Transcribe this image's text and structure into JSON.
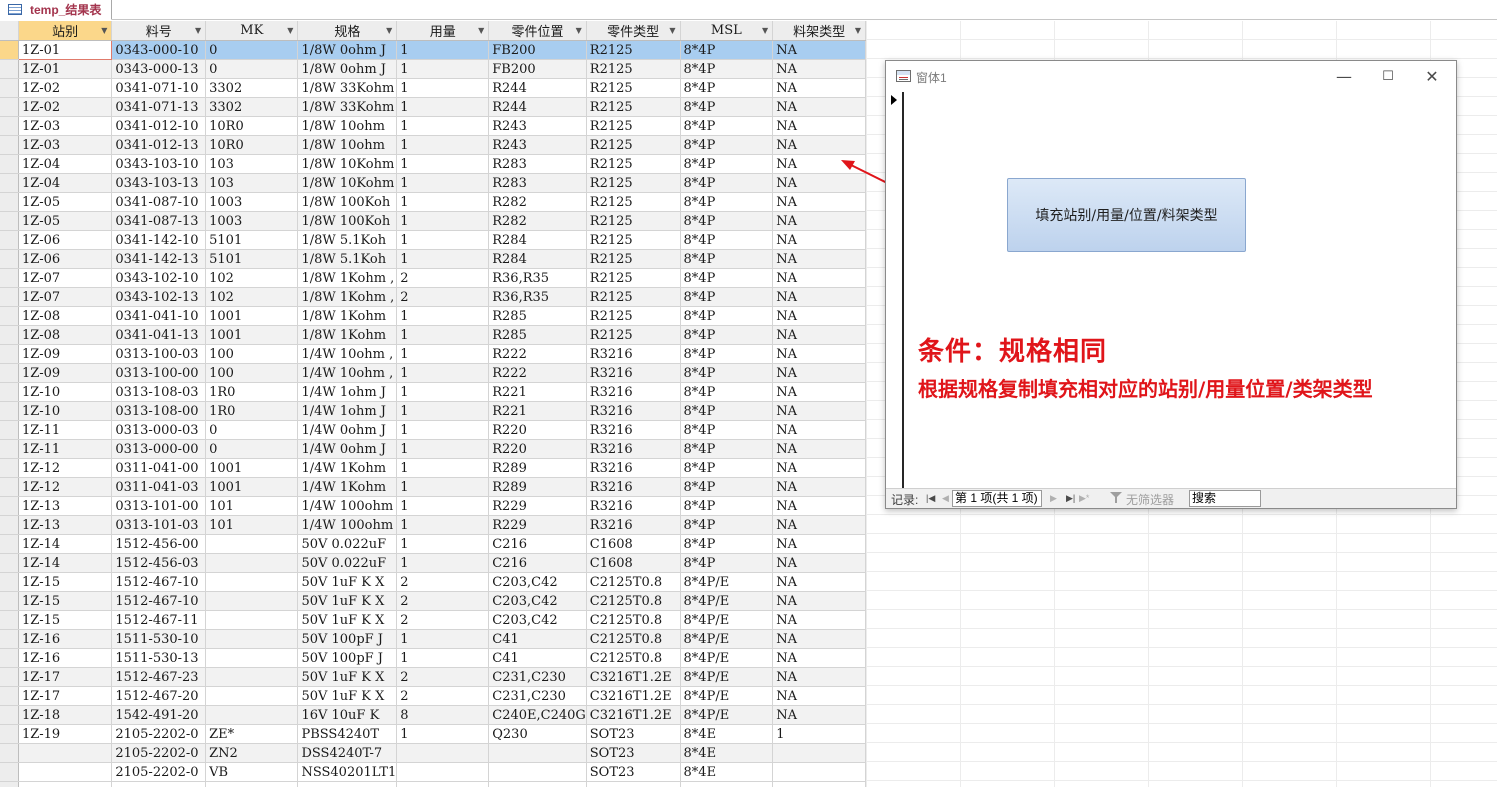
{
  "tab": {
    "label": "temp_结果表",
    "icon": "table-icon"
  },
  "datasheet": {
    "columns": [
      {
        "label": "站别"
      },
      {
        "label": "料号"
      },
      {
        "label": "MK"
      },
      {
        "label": "规格"
      },
      {
        "label": "用量"
      },
      {
        "label": "零件位置"
      },
      {
        "label": "零件类型"
      },
      {
        "label": "MSL"
      },
      {
        "label": "料架类型"
      }
    ],
    "rows": [
      [
        "1Z-01",
        "0343-000-10",
        "0",
        "1/8W 0ohm J",
        "1",
        "FB200",
        "R2125",
        "8*4P",
        "NA"
      ],
      [
        "1Z-01",
        "0343-000-13",
        "0",
        "1/8W 0ohm J",
        "1",
        "FB200",
        "R2125",
        "8*4P",
        "NA"
      ],
      [
        "1Z-02",
        "0341-071-10",
        "3302",
        "1/8W 33Kohm",
        "1",
        "R244",
        "R2125",
        "8*4P",
        "NA"
      ],
      [
        "1Z-02",
        "0341-071-13",
        "3302",
        "1/8W 33Kohm",
        "1",
        "R244",
        "R2125",
        "8*4P",
        "NA"
      ],
      [
        "1Z-03",
        "0341-012-10",
        "10R0",
        "1/8W 10ohm",
        "1",
        "R243",
        "R2125",
        "8*4P",
        "NA"
      ],
      [
        "1Z-03",
        "0341-012-13",
        "10R0",
        "1/8W 10ohm",
        "1",
        "R243",
        "R2125",
        "8*4P",
        "NA"
      ],
      [
        "1Z-04",
        "0343-103-10",
        "103",
        "1/8W 10Kohm",
        "1",
        "R283",
        "R2125",
        "8*4P",
        "NA"
      ],
      [
        "1Z-04",
        "0343-103-13",
        "103",
        "1/8W 10Kohm",
        "1",
        "R283",
        "R2125",
        "8*4P",
        "NA"
      ],
      [
        "1Z-05",
        "0341-087-10",
        "1003",
        "1/8W 100Koh",
        "1",
        "R282",
        "R2125",
        "8*4P",
        "NA"
      ],
      [
        "1Z-05",
        "0341-087-13",
        "1003",
        "1/8W 100Koh",
        "1",
        "R282",
        "R2125",
        "8*4P",
        "NA"
      ],
      [
        "1Z-06",
        "0341-142-10",
        "5101",
        "1/8W 5.1Koh",
        "1",
        "R284",
        "R2125",
        "8*4P",
        "NA"
      ],
      [
        "1Z-06",
        "0341-142-13",
        "5101",
        "1/8W 5.1Koh",
        "1",
        "R284",
        "R2125",
        "8*4P",
        "NA"
      ],
      [
        "1Z-07",
        "0343-102-10",
        "102",
        "1/8W 1Kohm ,",
        "2",
        "R36,R35",
        "R2125",
        "8*4P",
        "NA"
      ],
      [
        "1Z-07",
        "0343-102-13",
        "102",
        "1/8W 1Kohm ,",
        "2",
        "R36,R35",
        "R2125",
        "8*4P",
        "NA"
      ],
      [
        "1Z-08",
        "0341-041-10",
        "1001",
        "1/8W 1Kohm",
        "1",
        "R285",
        "R2125",
        "8*4P",
        "NA"
      ],
      [
        "1Z-08",
        "0341-041-13",
        "1001",
        "1/8W 1Kohm",
        "1",
        "R285",
        "R2125",
        "8*4P",
        "NA"
      ],
      [
        "1Z-09",
        "0313-100-03",
        "100",
        "1/4W 10ohm ,",
        "1",
        "R222",
        "R3216",
        "8*4P",
        "NA"
      ],
      [
        "1Z-09",
        "0313-100-00",
        "100",
        "1/4W 10ohm ,",
        "1",
        "R222",
        "R3216",
        "8*4P",
        "NA"
      ],
      [
        "1Z-10",
        "0313-108-03",
        "1R0",
        "1/4W 1ohm J",
        "1",
        "R221",
        "R3216",
        "8*4P",
        "NA"
      ],
      [
        "1Z-10",
        "0313-108-00",
        "1R0",
        "1/4W 1ohm J",
        "1",
        "R221",
        "R3216",
        "8*4P",
        "NA"
      ],
      [
        "1Z-11",
        "0313-000-03",
        "0",
        "1/4W 0ohm J",
        "1",
        "R220",
        "R3216",
        "8*4P",
        "NA"
      ],
      [
        "1Z-11",
        "0313-000-00",
        "0",
        "1/4W 0ohm J",
        "1",
        "R220",
        "R3216",
        "8*4P",
        "NA"
      ],
      [
        "1Z-12",
        "0311-041-00",
        "1001",
        "1/4W 1Kohm",
        "1",
        "R289",
        "R3216",
        "8*4P",
        "NA"
      ],
      [
        "1Z-12",
        "0311-041-03",
        "1001",
        "1/4W 1Kohm",
        "1",
        "R289",
        "R3216",
        "8*4P",
        "NA"
      ],
      [
        "1Z-13",
        "0313-101-00",
        "101",
        "1/4W 100ohm",
        "1",
        "R229",
        "R3216",
        "8*4P",
        "NA"
      ],
      [
        "1Z-13",
        "0313-101-03",
        "101",
        "1/4W 100ohm",
        "1",
        "R229",
        "R3216",
        "8*4P",
        "NA"
      ],
      [
        "1Z-14",
        "1512-456-00",
        "",
        "50V 0.022uF",
        "1",
        "C216",
        "C1608",
        "8*4P",
        "NA"
      ],
      [
        "1Z-14",
        "1512-456-03",
        "",
        "50V 0.022uF",
        "1",
        "C216",
        "C1608",
        "8*4P",
        "NA"
      ],
      [
        "1Z-15",
        "1512-467-10",
        "",
        "50V 1uF K X",
        "2",
        "C203,C42",
        "C2125T0.8",
        "8*4P/E",
        "NA"
      ],
      [
        "1Z-15",
        "1512-467-10",
        "",
        "50V 1uF K X",
        "2",
        "C203,C42",
        "C2125T0.8",
        "8*4P/E",
        "NA"
      ],
      [
        "1Z-15",
        "1512-467-11",
        "",
        "50V 1uF K X",
        "2",
        "C203,C42",
        "C2125T0.8",
        "8*4P/E",
        "NA"
      ],
      [
        "1Z-16",
        "1511-530-10",
        "",
        "50V 100pF J",
        "1",
        "C41",
        "C2125T0.8",
        "8*4P/E",
        "NA"
      ],
      [
        "1Z-16",
        "1511-530-13",
        "",
        "50V 100pF J",
        "1",
        "C41",
        "C2125T0.8",
        "8*4P/E",
        "NA"
      ],
      [
        "1Z-17",
        "1512-467-23",
        "",
        "50V 1uF K X",
        "2",
        "C231,C230",
        "C3216T1.2E",
        "8*4P/E",
        "NA"
      ],
      [
        "1Z-17",
        "1512-467-20",
        "",
        "50V 1uF K X",
        "2",
        "C231,C230",
        "C3216T1.2E",
        "8*4P/E",
        "NA"
      ],
      [
        "1Z-18",
        "1542-491-20",
        "",
        "16V 10uF K",
        "8",
        "C240E,C240G",
        "C3216T1.2E",
        "8*4P/E",
        "NA"
      ],
      [
        "1Z-19",
        "2105-2202-0",
        "ZE*",
        "PBSS4240T",
        "1",
        "Q230",
        "SOT23",
        "8*4E",
        "1"
      ],
      [
        "",
        "2105-2202-0",
        "ZN2",
        "DSS4240T-7",
        "",
        "",
        "SOT23",
        "8*4E",
        ""
      ],
      [
        "",
        "2105-2202-0",
        "VB",
        "NSS40201LT1",
        "",
        "",
        "SOT23",
        "8*4E",
        ""
      ],
      [
        "",
        "",
        "",
        "",
        "",
        "",
        "",
        "",
        ""
      ]
    ]
  },
  "form": {
    "title": "窗体1",
    "window_controls": {
      "minimize": "—",
      "maximize": "☐",
      "close": "✕"
    },
    "fill_button_label": "填充站别/用量/位置/料架类型",
    "condition_title": "条件：规格相同",
    "condition_desc": "根据规格复制填充相对应的站别/用量位置/类架类型",
    "nav": {
      "label": "记录:",
      "first": "|◀",
      "prev": "◀",
      "current": "第 1 项(共 1 项)",
      "next": "▶",
      "last": "▶|",
      "new": "▶*",
      "filter_label": "无筛选器",
      "search_value": "搜索"
    }
  },
  "colors": {
    "annotation": "#e0151a",
    "current_row": "#a8cdf0",
    "selected_header": "#fbd78a"
  }
}
